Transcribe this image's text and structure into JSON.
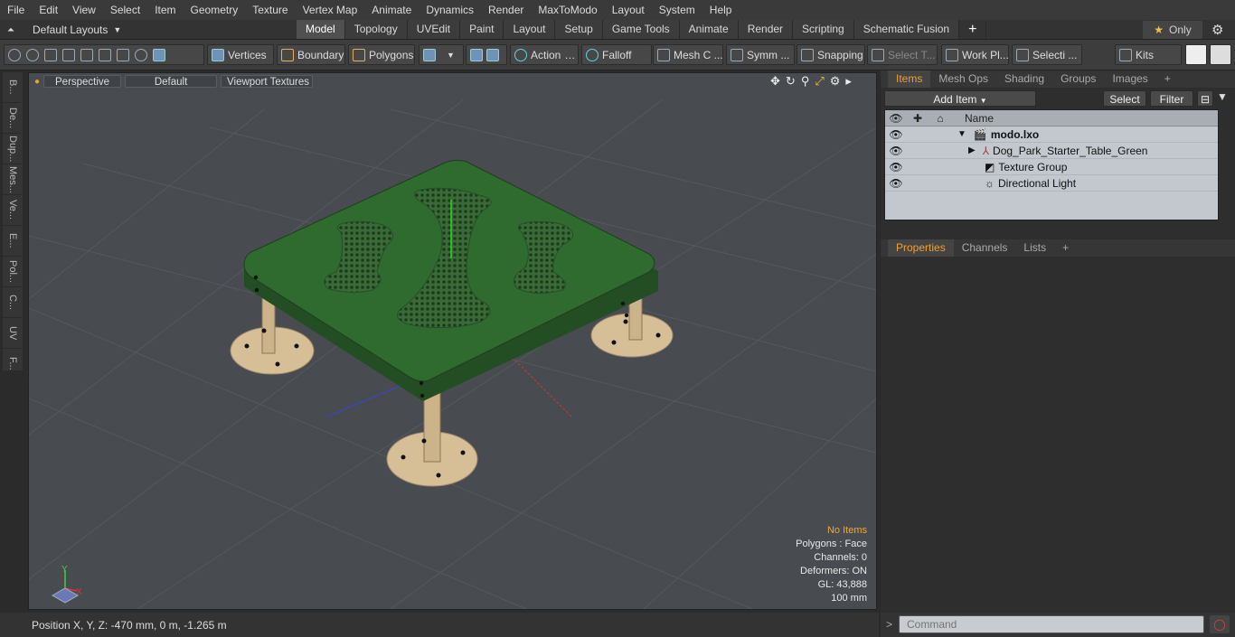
{
  "menubar": {
    "items": [
      "File",
      "Edit",
      "View",
      "Select",
      "Item",
      "Geometry",
      "Texture",
      "Vertex Map",
      "Animate",
      "Dynamics",
      "Render",
      "MaxToModo",
      "Layout",
      "System",
      "Help"
    ]
  },
  "layouts": {
    "label": "Default Layouts"
  },
  "tabs": [
    {
      "label": "Model",
      "active": true
    },
    {
      "label": "Topology"
    },
    {
      "label": "UVEdit"
    },
    {
      "label": "Paint"
    },
    {
      "label": "Layout"
    },
    {
      "label": "Setup"
    },
    {
      "label": "Game Tools"
    },
    {
      "label": "Animate"
    },
    {
      "label": "Render"
    },
    {
      "label": "Scripting"
    },
    {
      "label": "Schematic Fusion"
    }
  ],
  "only_label": "Only",
  "toolbar": {
    "vertices": "Vertices",
    "boundary": "Boundary",
    "polygons": "Polygons",
    "action": "Action",
    "falloff": "Falloff",
    "mesh": "Mesh C ...",
    "symm": "Symm ...",
    "snapping": "Snapping",
    "select_t": "Select T...",
    "work_pl": "Work Pl...",
    "selecti": "Selecti ...",
    "kits": "Kits"
  },
  "left_tabs": [
    "B...",
    "De...",
    "Dup...",
    "Mes...",
    "Ve...",
    "E...",
    "Pol...",
    "C...",
    "UV",
    "F..."
  ],
  "viewport": {
    "perspective": "Perspective",
    "default": "Default",
    "textures": "Viewport Textures",
    "stats": {
      "no_items": "No Items",
      "polygons": "Polygons : Face",
      "channels": "Channels: 0",
      "deformers": "Deformers: ON",
      "gl": "GL: 43,888",
      "scale": "100 mm"
    },
    "axis": {
      "y": "Y",
      "x": "X"
    }
  },
  "status": {
    "position": "Position X, Y, Z:   -470 mm, 0 m, -1.265 m"
  },
  "items_panel": {
    "tabs": [
      "Items",
      "Mesh Ops",
      "Shading",
      "Groups",
      "Images"
    ],
    "add_item": "Add Item",
    "select": "Select",
    "filter": "Filter",
    "column_name": "Name",
    "rows": [
      {
        "label": "modo.lxo",
        "bold": true
      },
      {
        "label": "Dog_Park_Starter_Table_Green"
      },
      {
        "label": "Texture Group"
      },
      {
        "label": "Directional Light"
      }
    ]
  },
  "props_panel": {
    "tabs": [
      "Properties",
      "Channels",
      "Lists"
    ]
  },
  "command": {
    "placeholder": "Command"
  },
  "colors": {
    "accent": "#f0a030",
    "table_green": "#2f6a2f",
    "base": "#d7c19a"
  }
}
